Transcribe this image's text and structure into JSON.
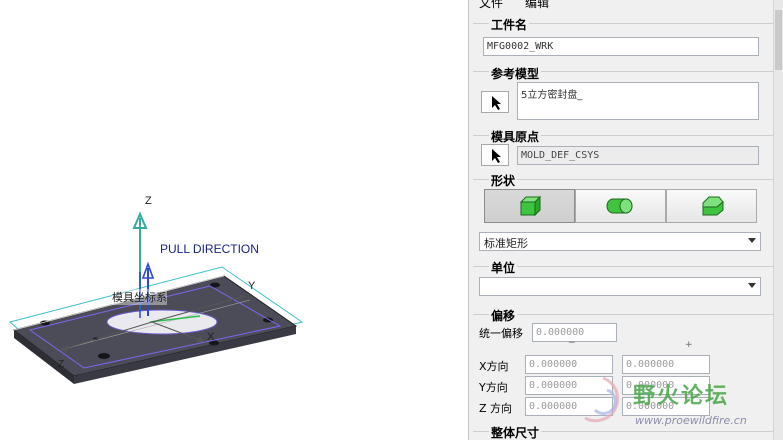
{
  "viewport": {
    "pull_direction": "PULL DIRECTION",
    "axis_z": "Z",
    "axis_y": "Y",
    "axis_x": "X",
    "axis_z2": "Z",
    "csys_tag": "模具坐标系"
  },
  "menu": {
    "file": "文件",
    "edit": "编辑"
  },
  "workpiece_name": {
    "title": "工件名",
    "value": "MFG0002_WRK"
  },
  "reference_model": {
    "title": "参考模型",
    "value": "5立方密封盘_"
  },
  "mold_origin": {
    "title": "模具原点",
    "value": "MOLD_DEF_CSYS"
  },
  "shape": {
    "title": "形状",
    "buttons": [
      "box-shape",
      "cylinder-shape",
      "custom-shape"
    ],
    "selected": "标准矩形"
  },
  "units": {
    "title": "单位",
    "selected": ""
  },
  "offset": {
    "title": "偏移",
    "uniform_label": "统一偏移",
    "uniform_value": "0.000000",
    "minus_mark": "−",
    "plus_mark": "+",
    "rows": [
      {
        "label": "X方向",
        "minus": "0.000000",
        "plus": "0.000000"
      },
      {
        "label": "Y方向",
        "minus": "0.000000",
        "plus": "0.000000"
      },
      {
        "label": "Z 方向",
        "minus": "0.000000",
        "plus": "0.000000"
      }
    ]
  },
  "overall_size": {
    "title": "整体尺寸"
  },
  "watermark": {
    "title": "野火论坛",
    "url": "www.proewildfire.cn"
  },
  "colors": {
    "accent_green": "#3fbf3f",
    "panel_bg": "#f0f0f0",
    "viewport_bg": "#ffffff"
  }
}
